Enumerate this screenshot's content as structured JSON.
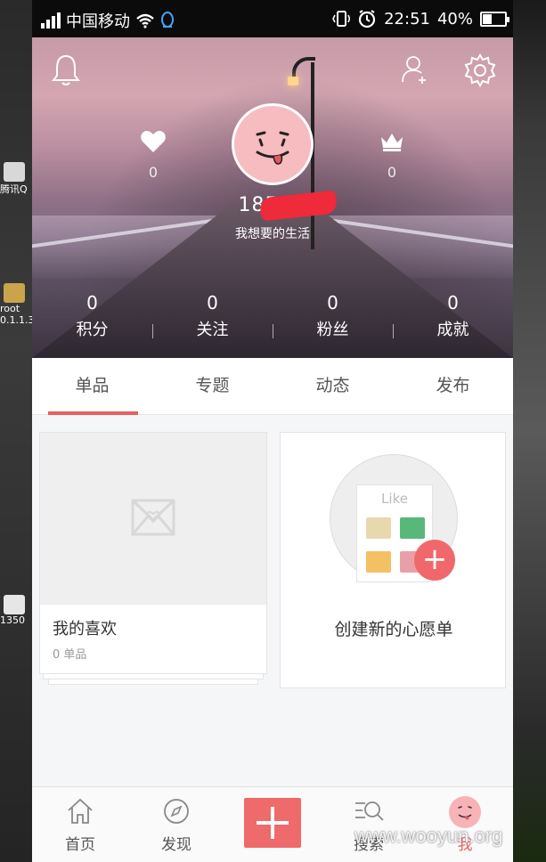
{
  "status_bar": {
    "carrier": "中国移动",
    "time": "22:51",
    "battery_percent": "40%",
    "battery_level": 0.4
  },
  "desktop_fragments": {
    "item1_label": "腾讯Q",
    "item2_label": "root",
    "item2_sub": "0.1.1.3",
    "item3_label": "1350"
  },
  "header": {
    "likes_count": "0",
    "crown_count": "0",
    "username": "185*      *",
    "slogan": "我想要的生活",
    "stats": [
      {
        "value": "0",
        "label": "积分"
      },
      {
        "value": "0",
        "label": "关注"
      },
      {
        "value": "0",
        "label": "粉丝"
      },
      {
        "value": "0",
        "label": "成就"
      }
    ]
  },
  "tabs": [
    {
      "label": "单品",
      "active": true
    },
    {
      "label": "专题",
      "active": false
    },
    {
      "label": "动态",
      "active": false
    },
    {
      "label": "发布",
      "active": false
    }
  ],
  "cards": {
    "favorites_title": "我的喜欢",
    "favorites_sub": "0 单品",
    "like_label": "Like",
    "create_title": "创建新的心愿单"
  },
  "bottom_nav": [
    {
      "label": "首页",
      "icon": "home-icon"
    },
    {
      "label": "发现",
      "icon": "compass-icon"
    },
    {
      "label": "",
      "icon": "plus-icon"
    },
    {
      "label": "搜索",
      "icon": "search-icon"
    },
    {
      "label": "我",
      "icon": "avatar-icon"
    }
  ],
  "watermark": "www.wooyun.org",
  "colors": {
    "accent": "#e95e5e",
    "add_button": "#ef6a6b",
    "avatar_pink": "#f6bcc0"
  }
}
